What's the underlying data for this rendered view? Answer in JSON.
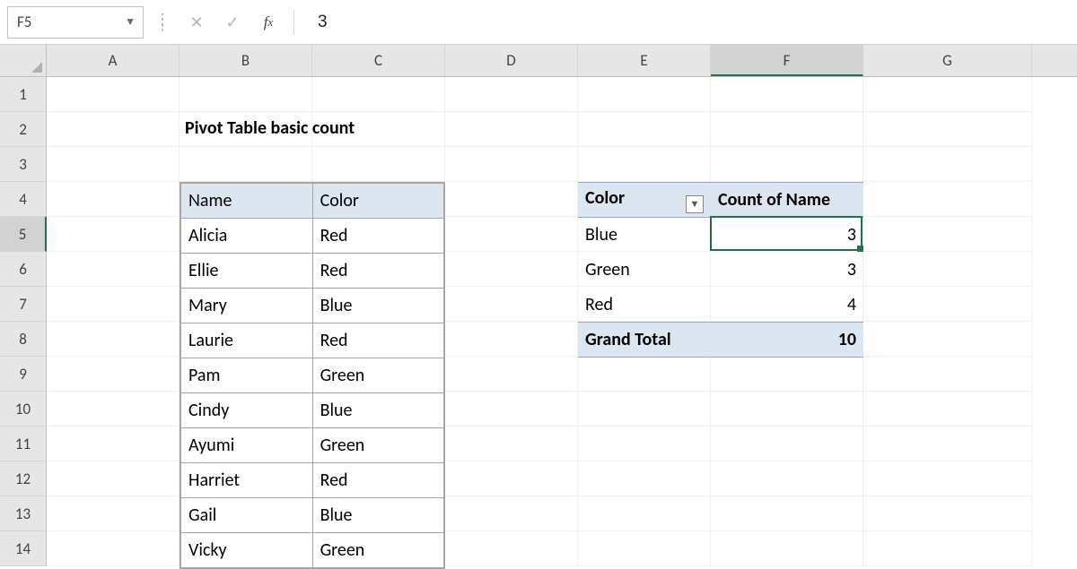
{
  "accent_color": "#217346",
  "header_fill": "#dce6f1",
  "formula_bar": {
    "name_box": "F5",
    "formula_value": "3"
  },
  "columns": [
    "A",
    "B",
    "C",
    "D",
    "E",
    "F",
    "G"
  ],
  "rows": [
    "1",
    "2",
    "3",
    "4",
    "5",
    "6",
    "7",
    "8",
    "9",
    "10",
    "11",
    "12",
    "13",
    "14"
  ],
  "active_col": "F",
  "active_row": "5",
  "title": "Pivot Table basic count",
  "source_table": {
    "headers": [
      "Name",
      "Color"
    ],
    "rows": [
      [
        "Alicia",
        "Red"
      ],
      [
        "Ellie",
        "Red"
      ],
      [
        "Mary",
        "Blue"
      ],
      [
        "Laurie",
        "Red"
      ],
      [
        "Pam",
        "Green"
      ],
      [
        "Cindy",
        "Blue"
      ],
      [
        "Ayumi",
        "Green"
      ],
      [
        "Harriet",
        "Red"
      ],
      [
        "Gail",
        "Blue"
      ],
      [
        "Vicky",
        "Green"
      ]
    ]
  },
  "pivot_table": {
    "headers": [
      "Color",
      "Count of Name"
    ],
    "rows": [
      [
        "Blue",
        "3"
      ],
      [
        "Green",
        "3"
      ],
      [
        "Red",
        "4"
      ]
    ],
    "grand_total_label": "Grand Total",
    "grand_total_value": "10"
  }
}
